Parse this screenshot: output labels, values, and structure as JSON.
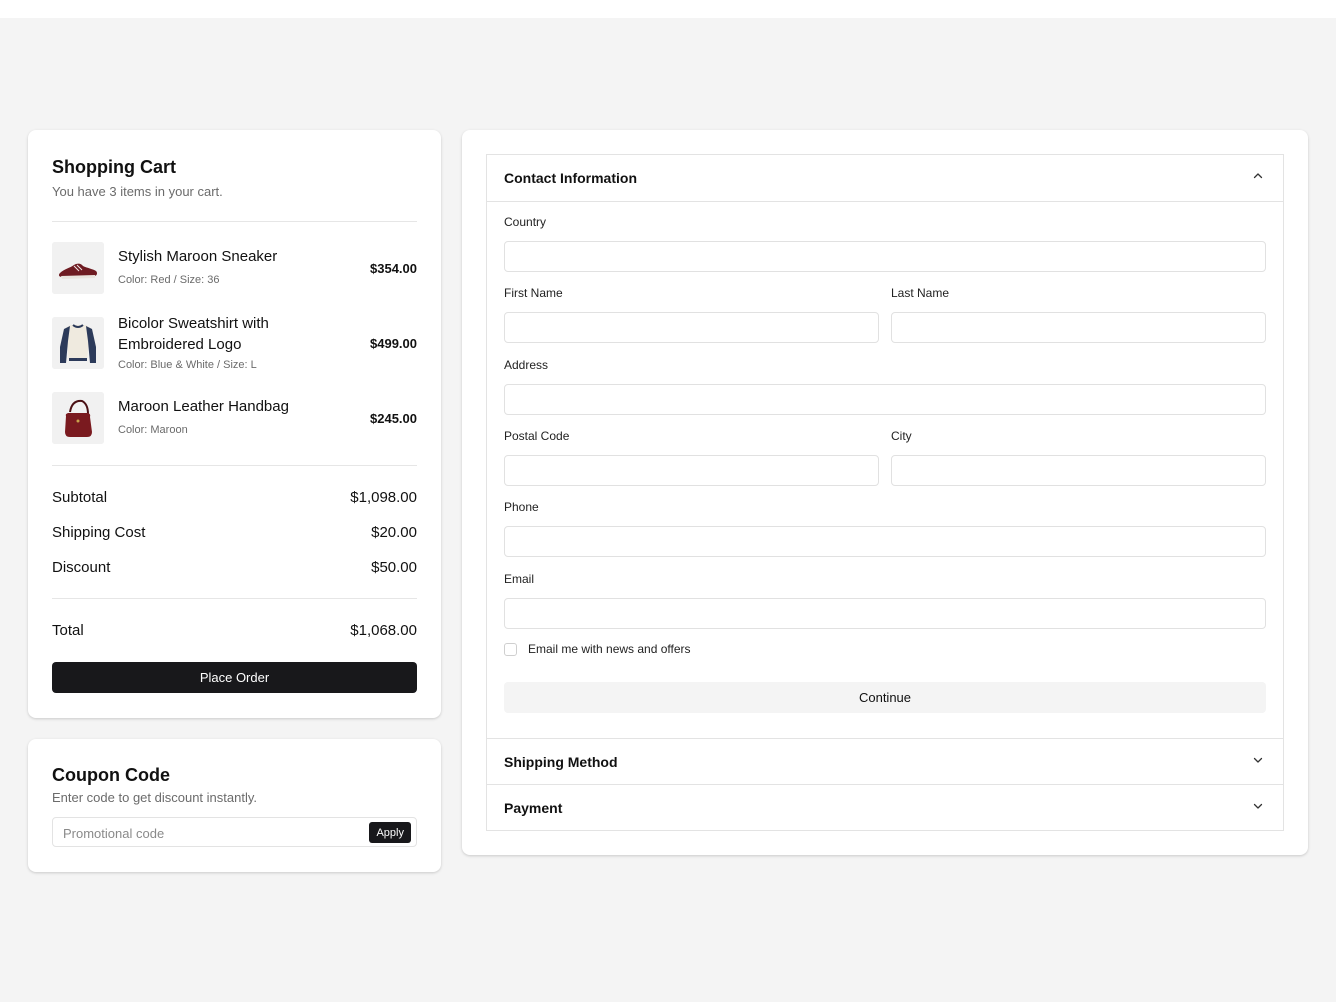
{
  "cart": {
    "title": "Shopping Cart",
    "subtitle": "You have 3 items in your cart.",
    "items": [
      {
        "name": "Stylish Maroon Sneaker",
        "meta": "Color: Red / Size: 36",
        "price": "$354.00",
        "icon": "sneaker-image"
      },
      {
        "name": "Bicolor Sweatshirt with Embroidered Logo",
        "meta": "Color: Blue & White / Size: L",
        "price": "$499.00",
        "icon": "sweatshirt-image"
      },
      {
        "name": "Maroon Leather Handbag",
        "meta": "Color: Maroon",
        "price": "$245.00",
        "icon": "handbag-image"
      }
    ],
    "summary": {
      "subtotal_label": "Subtotal",
      "subtotal": "$1,098.00",
      "shipping_label": "Shipping Cost",
      "shipping": "$20.00",
      "discount_label": "Discount",
      "discount": "$50.00",
      "total_label": "Total",
      "total": "$1,068.00"
    },
    "place_order": "Place Order"
  },
  "coupon": {
    "title": "Coupon Code",
    "subtitle": "Enter code to get discount instantly.",
    "placeholder": "Promotional code",
    "apply": "Apply"
  },
  "checkout": {
    "contact": {
      "title": "Contact Information",
      "expanded": true,
      "fields": {
        "country": "Country",
        "first_name": "First Name",
        "last_name": "Last Name",
        "address": "Address",
        "postal_code": "Postal Code",
        "city": "City",
        "phone": "Phone",
        "email": "Email"
      },
      "newsletter": "Email me with news and offers",
      "continue": "Continue"
    },
    "shipping": {
      "title": "Shipping Method",
      "expanded": false
    },
    "payment": {
      "title": "Payment",
      "expanded": false
    }
  },
  "colors": {
    "background": "#f4f4f4",
    "primary_button": "#18181b",
    "secondary_button": "#f4f4f4",
    "border": "#e3e3e3"
  }
}
